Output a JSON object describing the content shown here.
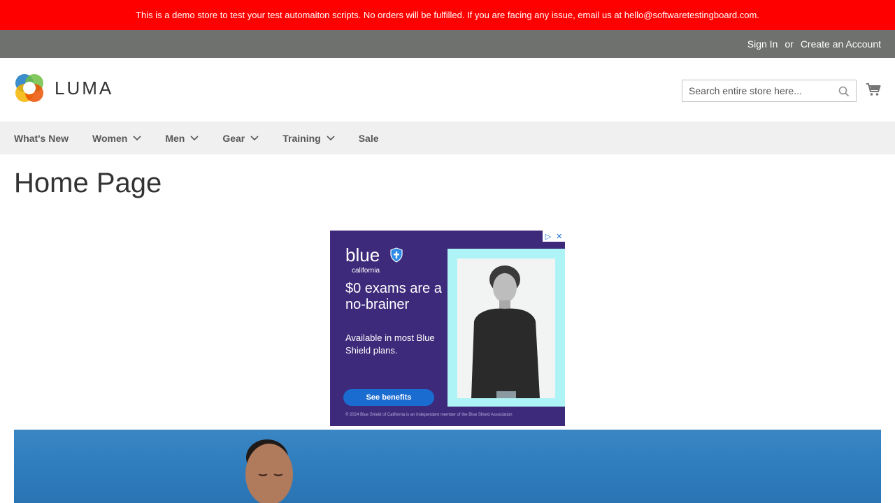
{
  "banner": {
    "text": "This is a demo store to test your test automaiton scripts. No orders will be fulfilled. If you are facing any issue, email us at hello@softwaretestingboard.com."
  },
  "panel": {
    "sign_in": "Sign In",
    "or": "or",
    "create_account": "Create an Account"
  },
  "header": {
    "logo_text": "LUMA",
    "search_placeholder": "Search entire store here...",
    "search_icon": "search-icon",
    "cart_icon": "shopping-cart-icon"
  },
  "nav": {
    "items": [
      {
        "label": "What's New",
        "has_dropdown": false
      },
      {
        "label": "Women",
        "has_dropdown": true
      },
      {
        "label": "Men",
        "has_dropdown": true
      },
      {
        "label": "Gear",
        "has_dropdown": true
      },
      {
        "label": "Training",
        "has_dropdown": true
      },
      {
        "label": "Sale",
        "has_dropdown": false
      }
    ]
  },
  "main": {
    "page_title": "Home Page"
  },
  "ad": {
    "brand": "blue",
    "brand_sub": "california",
    "headline": "$0 exams are a no-brainer",
    "subtext": "Available in most Blue Shield plans.",
    "button": "See benefits",
    "footer": "© 2024 Blue Shield of California is an independent member of the Blue Shield Association"
  },
  "colors": {
    "banner_bg": "#ff0000",
    "panel_bg": "#6e716e",
    "nav_bg": "#f0f0f0",
    "ad_bg": "#3d2a7a",
    "ad_button": "#1a6cd1",
    "hero_sky": "#3b86c4"
  }
}
